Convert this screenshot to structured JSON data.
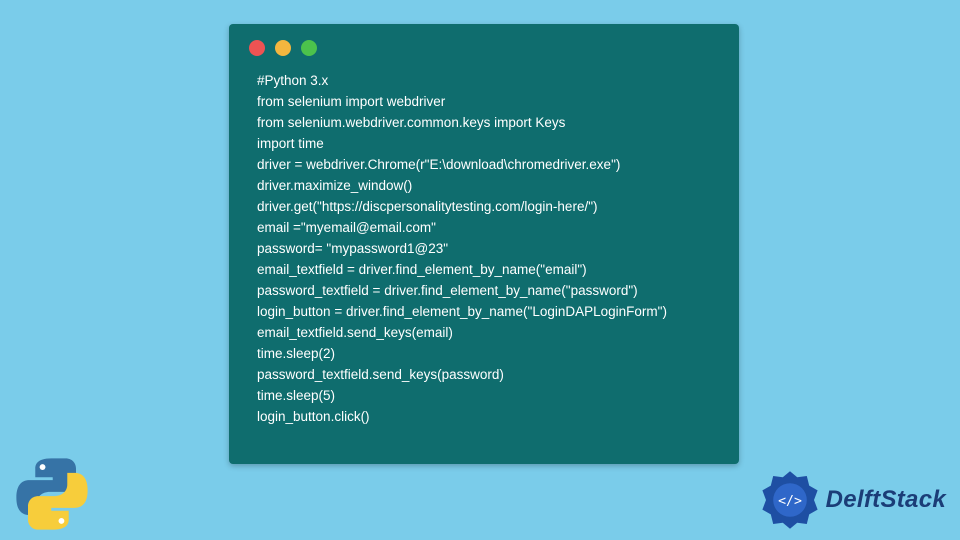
{
  "window": {
    "dots": [
      "red",
      "yellow",
      "green"
    ]
  },
  "code": {
    "lines": [
      "#Python 3.x",
      "from selenium import webdriver",
      "from selenium.webdriver.common.keys import Keys",
      "import time",
      "driver = webdriver.Chrome(r\"E:\\download\\chromedriver.exe\")",
      "driver.maximize_window()",
      "driver.get(\"https://discpersonalitytesting.com/login-here/\")",
      "email =\"myemail@email.com\"",
      "password= \"mypassword1@23\"",
      "email_textfield = driver.find_element_by_name(\"email\")",
      "password_textfield = driver.find_element_by_name(\"password\")",
      "login_button = driver.find_element_by_name(\"LoginDAPLoginForm\")",
      "email_textfield.send_keys(email)",
      "time.sleep(2)",
      "password_textfield.send_keys(password)",
      "time.sleep(5)",
      "login_button.click()"
    ]
  },
  "brand": {
    "name": "DelftStack"
  },
  "colors": {
    "page_bg": "#7accea",
    "card_bg": "#0f6d6e",
    "code_fg": "#ffffff",
    "brand_fg": "#1b3d77"
  }
}
